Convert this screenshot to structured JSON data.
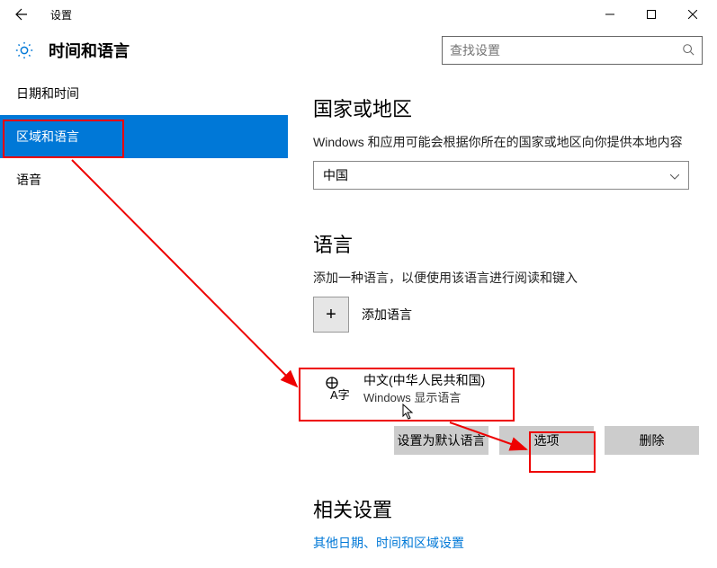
{
  "window": {
    "title": "设置"
  },
  "header": {
    "page_title": "时间和语言",
    "search_placeholder": "查找设置"
  },
  "sidebar": {
    "items": [
      {
        "label": "日期和时间"
      },
      {
        "label": "区域和语言"
      },
      {
        "label": "语音"
      }
    ]
  },
  "content": {
    "region": {
      "heading": "国家或地区",
      "desc": "Windows 和应用可能会根据你所在的国家或地区向你提供本地内容",
      "selected": "中国"
    },
    "language": {
      "heading": "语言",
      "desc": "添加一种语言，以便使用该语言进行阅读和键入",
      "add_label": "添加语言",
      "item": {
        "name": "中文(中华人民共和国)",
        "sub": "Windows 显示语言"
      },
      "buttons": {
        "default": "设置为默认语言",
        "options": "选项",
        "remove": "删除"
      }
    },
    "related": {
      "heading": "相关设置",
      "link": "其他日期、时间和区域设置"
    }
  }
}
